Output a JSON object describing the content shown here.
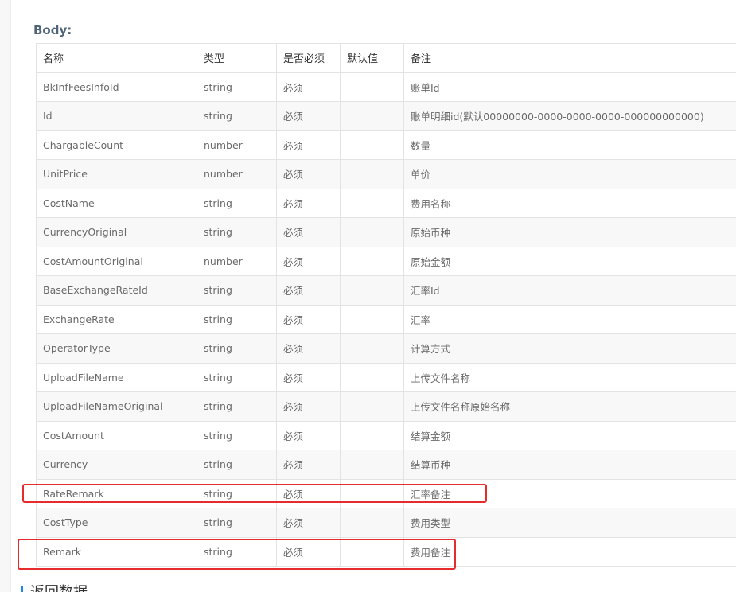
{
  "body_section": {
    "label": "Body:"
  },
  "table": {
    "headers": [
      "名称",
      "类型",
      "是否必须",
      "默认值",
      "备注"
    ],
    "rows": [
      [
        "BkInfFeesInfoId",
        "string",
        "必须",
        "",
        "账单Id"
      ],
      [
        "Id",
        "string",
        "必须",
        "",
        "账单明细id(默认00000000-0000-0000-0000-000000000000)"
      ],
      [
        "ChargableCount",
        "number",
        "必须",
        "",
        "数量"
      ],
      [
        "UnitPrice",
        "number",
        "必须",
        "",
        "单价"
      ],
      [
        "CostName",
        "string",
        "必须",
        "",
        "费用名称"
      ],
      [
        "CurrencyOriginal",
        "string",
        "必须",
        "",
        "原始币种"
      ],
      [
        "CostAmountOriginal",
        "number",
        "必须",
        "",
        "原始金额"
      ],
      [
        "BaseExchangeRateId",
        "string",
        "必须",
        "",
        "汇率Id"
      ],
      [
        "ExchangeRate",
        "string",
        "必须",
        "",
        "汇率"
      ],
      [
        "OperatorType",
        "string",
        "必须",
        "",
        "计算方式"
      ],
      [
        "UploadFileName",
        "string",
        "必须",
        "",
        "上传文件名称"
      ],
      [
        "UploadFileNameOriginal",
        "string",
        "必须",
        "",
        "上传文件名称原始名称"
      ],
      [
        "CostAmount",
        "string",
        "必须",
        "",
        "结算金额"
      ],
      [
        "Currency",
        "string",
        "必须",
        "",
        "结算币种"
      ],
      [
        "RateRemark",
        "string",
        "必须",
        "",
        "汇率备注"
      ],
      [
        "CostType",
        "string",
        "必须",
        "",
        "费用类型"
      ],
      [
        "Remark",
        "string",
        "必须",
        "",
        "费用备注"
      ]
    ]
  },
  "next_section": {
    "title": "返回数据"
  },
  "colors": {
    "highlight_border": "#e52b2b",
    "section_label": "#4f6477",
    "accent_bar": "#1e88e5"
  }
}
